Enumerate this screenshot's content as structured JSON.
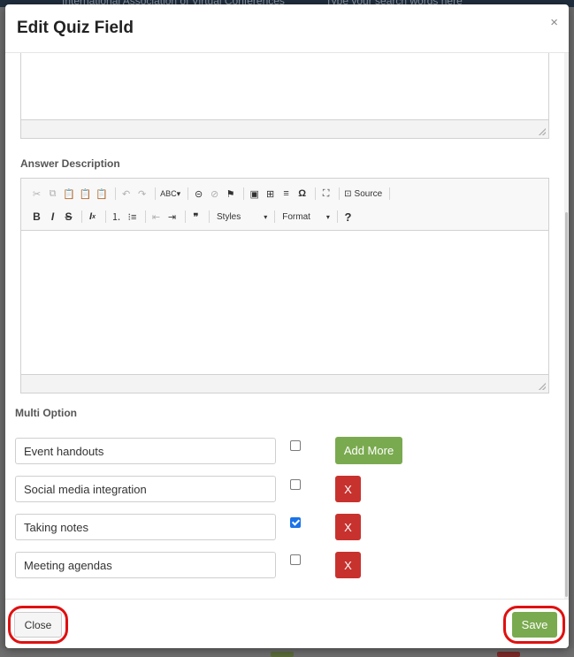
{
  "background": {
    "org_name": "International Association of Virtual Conferences",
    "search_placeholder": "Type your search words here"
  },
  "modal": {
    "title": "Edit Quiz Field",
    "close_symbol": "×"
  },
  "answer_description": {
    "label": "Answer Description",
    "toolbar": {
      "row1": [
        "cut-icon",
        "copy-icon",
        "paste-icon",
        "paste-text-icon",
        "paste-word-icon",
        "undo-icon",
        "redo-icon",
        "spellcheck-icon",
        "link-icon",
        "unlink-icon",
        "anchor-icon",
        "image-icon",
        "table-icon",
        "horizontal-line-icon",
        "special-char-icon",
        "maximize-icon",
        "source-icon"
      ],
      "source_label": "Source",
      "bold": "B",
      "italic": "I",
      "strike": "S",
      "styles_label": "Styles",
      "format_label": "Format",
      "help": "?"
    }
  },
  "multi_option": {
    "label": "Multi Option",
    "options": [
      {
        "value": "Event handouts",
        "checked": false
      },
      {
        "value": "Social media integration",
        "checked": false
      },
      {
        "value": "Taking notes",
        "checked": true
      },
      {
        "value": "Meeting agendas",
        "checked": false
      }
    ],
    "add_more_label": "Add More",
    "remove_label": "X"
  },
  "footer": {
    "close_label": "Close",
    "save_label": "Save"
  },
  "colors": {
    "green": "#7aaa4f",
    "red": "#c8322e",
    "highlight": "#e01010"
  }
}
